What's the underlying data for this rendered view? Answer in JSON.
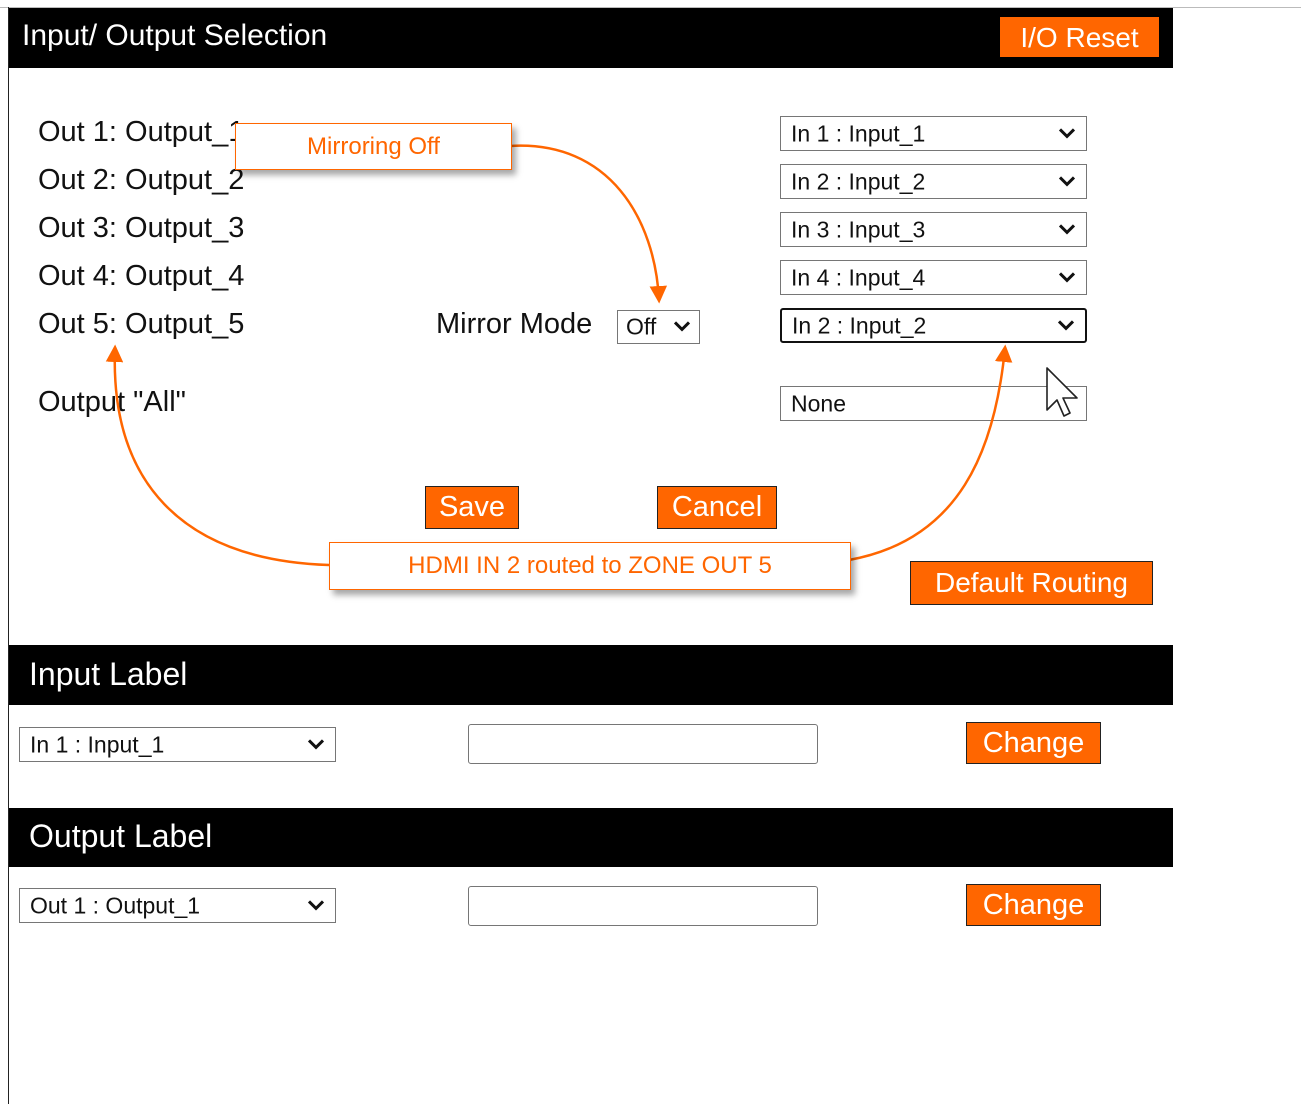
{
  "io_section": {
    "title": "Input/ Output Selection",
    "reset_label": "I/O Reset",
    "outputs": [
      {
        "label": "Out 1: Output_1",
        "route": "In 1 : Input_1"
      },
      {
        "label": "Out 2: Output_2",
        "route": "In 2 : Input_2"
      },
      {
        "label": "Out 3: Output_3",
        "route": "In 3 : Input_3"
      },
      {
        "label": "Out 4: Output_4",
        "route": "In 4 : Input_4"
      },
      {
        "label": "Out 5: Output_5",
        "route": "In 2 : Input_2"
      }
    ],
    "mirror_mode_label": "Mirror Mode",
    "mirror_mode_value": "Off",
    "output_all_label": "Output \"All\"",
    "output_all_value": "None",
    "save_label": "Save",
    "cancel_label": "Cancel",
    "default_routing_label": "Default Routing"
  },
  "annotations": {
    "mirroring_off": "Mirroring Off",
    "hdmi_routed": "HDMI IN 2 routed to ZONE OUT 5"
  },
  "input_label_section": {
    "title": "Input Label",
    "select_value": "In 1 : Input_1",
    "text_value": "",
    "change_label": "Change"
  },
  "output_label_section": {
    "title": "Output Label",
    "select_value": "Out 1 : Output_1",
    "text_value": "",
    "change_label": "Change"
  },
  "colors": {
    "accent": "#ff6600",
    "header_bg": "#000000",
    "header_text": "#ffffff"
  },
  "icons": [
    "chevron-down-icon",
    "mouse-cursor-icon",
    "arrow-icon"
  ]
}
